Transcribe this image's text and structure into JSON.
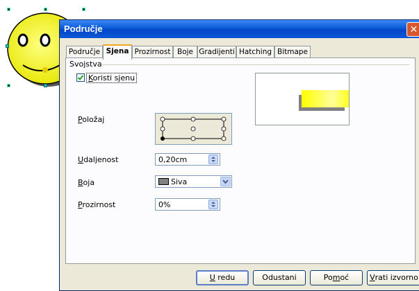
{
  "dialog": {
    "title": "Područje",
    "close_icon": "close-icon"
  },
  "tabs": [
    {
      "label": "Područje",
      "active": false
    },
    {
      "label": "Sjena",
      "active": true
    },
    {
      "label": "Prozirnost",
      "active": false
    },
    {
      "label": "Boje",
      "active": false
    },
    {
      "label": "Gradijenti",
      "active": false
    },
    {
      "label": "Hatching",
      "active": false
    },
    {
      "label": "Bitmape",
      "active": false
    }
  ],
  "properties": {
    "group_label": "Svojstva",
    "use_shadow": {
      "label_underline": "K",
      "label_rest": "oristi sjenu",
      "checked": true
    },
    "position": {
      "label_underline": "P",
      "label_rest": "oložaj",
      "selected": "bottom-left"
    },
    "distance": {
      "label_underline": "U",
      "label_rest": "daljenost",
      "value": "0,20cm"
    },
    "color": {
      "label_underline": "B",
      "label_rest": "oja",
      "value": "Siva",
      "swatch": "#808080"
    },
    "transparency": {
      "label_underline": "P",
      "label_rest": "rozirnost",
      "value": "0%"
    }
  },
  "preview": {
    "fill_color": "#ffff33",
    "shadow_color": "#808080"
  },
  "buttons": {
    "ok": {
      "underline": "U",
      "rest": " redu"
    },
    "cancel": "Odustani",
    "help": {
      "pre": "Po",
      "underline": "m",
      "post": "oć"
    },
    "reset": {
      "underline": "V",
      "rest": "rati izvorno"
    }
  },
  "colors": {
    "title_bar": "#0a5ad8",
    "dialog_bg": "#ece9d8",
    "active_tab_accent": "#f5a623"
  }
}
